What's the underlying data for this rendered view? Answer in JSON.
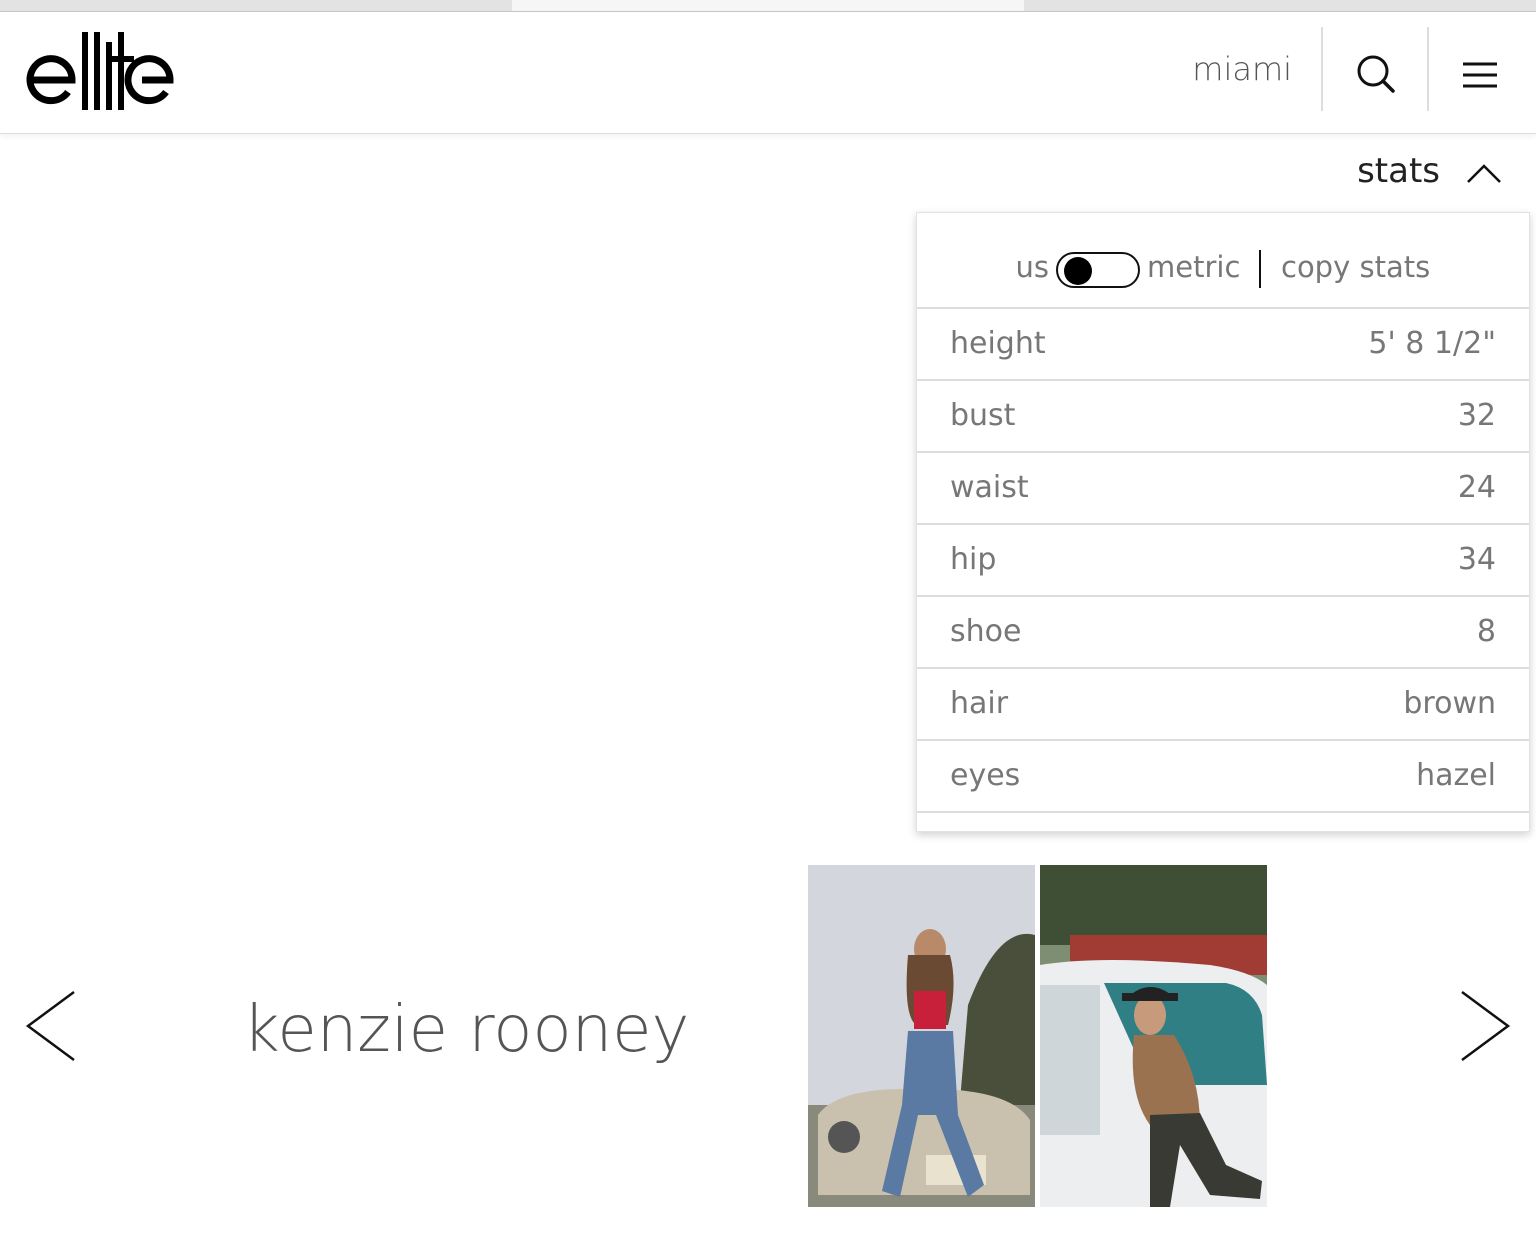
{
  "header": {
    "logo_text": "elite",
    "city": "miami"
  },
  "stats": {
    "toggle_label": "stats",
    "unit_us": "us",
    "unit_metric": "metric",
    "copy_label": "copy stats",
    "rows": [
      {
        "key": "height",
        "value": "5' 8 1/2\""
      },
      {
        "key": "bust",
        "value": "32"
      },
      {
        "key": "waist",
        "value": "24"
      },
      {
        "key": "hip",
        "value": "34"
      },
      {
        "key": "shoe",
        "value": "8"
      },
      {
        "key": "hair",
        "value": "brown"
      },
      {
        "key": "eyes",
        "value": "hazel"
      }
    ]
  },
  "model": {
    "name": "kenzie rooney"
  },
  "icons": {
    "search": "search-icon",
    "menu": "hamburger-menu-icon",
    "collapse": "chevron-up-icon",
    "prev": "chevron-left-icon",
    "next": "chevron-right-icon"
  },
  "colors": {
    "text": "#666666",
    "accent": "#000000",
    "divider": "#dddddd"
  }
}
